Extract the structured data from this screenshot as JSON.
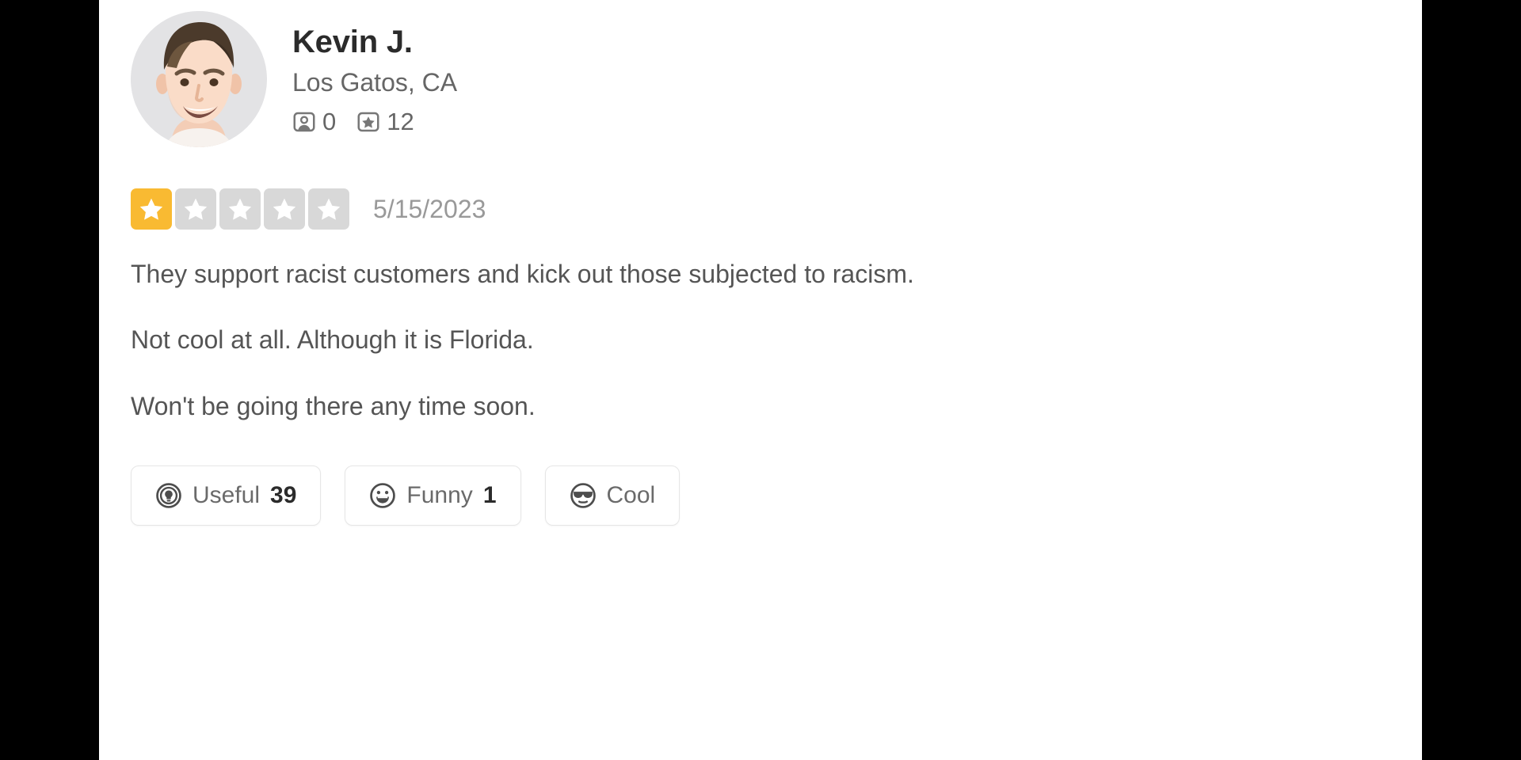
{
  "review": {
    "author": {
      "name": "Kevin J.",
      "location": "Los Gatos, CA",
      "avatar_icon": "user-portrait-avatar",
      "stats": [
        {
          "icon": "photo-icon",
          "label": "photos",
          "value": "0"
        },
        {
          "icon": "star-badge-icon",
          "label": "reviews",
          "value": "12"
        }
      ]
    },
    "rating": {
      "value": 1,
      "max": 5,
      "filled_color": "#f9ba32",
      "empty_color": "#d8d8d8"
    },
    "date": "5/15/2023",
    "paragraphs": [
      "They support racist customers and kick out those subjected to racism.",
      "Not cool at all. Although it is Florida.",
      "Won't be going there any time soon."
    ],
    "actions": [
      {
        "icon": "lightbulb-icon",
        "label": "Useful",
        "count": "39"
      },
      {
        "icon": "laughing-face-icon",
        "label": "Funny",
        "count": "1"
      },
      {
        "icon": "sunglasses-face-icon",
        "label": "Cool",
        "count": ""
      }
    ]
  }
}
